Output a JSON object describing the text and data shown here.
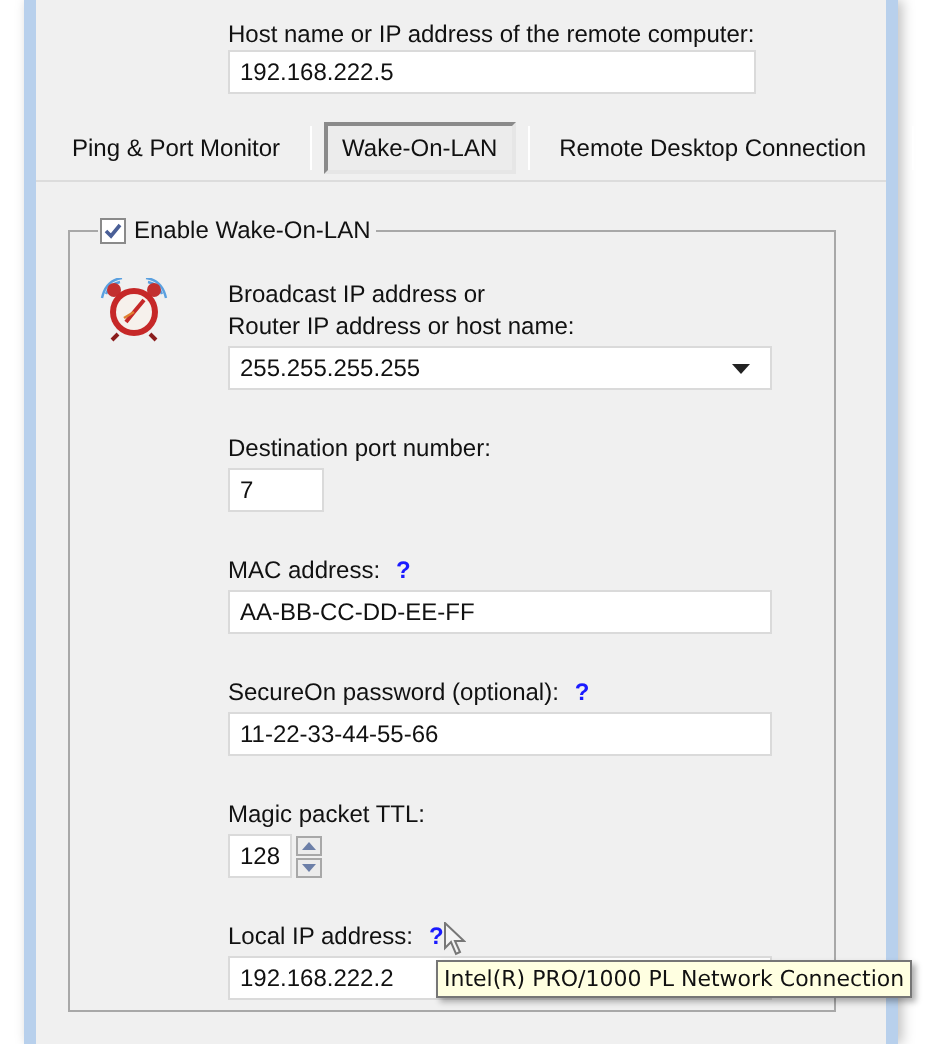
{
  "remote_host": {
    "label": "Host name or IP address of the remote computer:",
    "value": "192.168.222.5"
  },
  "tabs": [
    {
      "label": "Ping & Port Monitor",
      "selected": false
    },
    {
      "label": "Wake-On-LAN",
      "selected": true
    },
    {
      "label": "Remote Desktop Connection",
      "selected": false
    }
  ],
  "wake_on_lan": {
    "enable": {
      "label": "Enable Wake-On-LAN",
      "checked": true
    },
    "fields": [
      {
        "kind": "combo",
        "label_lines": [
          "Broadcast IP address or",
          "Router IP address or host name:"
        ],
        "value": "255.255.255.255"
      },
      {
        "kind": "number",
        "label_lines": [
          "Destination port number:"
        ],
        "value": "7"
      },
      {
        "kind": "text",
        "label_lines": [
          "MAC address:"
        ],
        "help": "?",
        "value": "AA-BB-CC-DD-EE-FF"
      },
      {
        "kind": "text",
        "label_lines": [
          "SecureOn password (optional):"
        ],
        "help": "?",
        "value": "11-22-33-44-55-66"
      },
      {
        "kind": "spinner",
        "label_lines": [
          "Magic packet TTL:"
        ],
        "value": "128"
      },
      {
        "kind": "text",
        "label_lines": [
          "Local IP address:"
        ],
        "help": "?",
        "value": "192.168.222.2"
      }
    ]
  },
  "tooltip": {
    "text": "Intel(R) PRO/1000 PL Network Connection"
  }
}
